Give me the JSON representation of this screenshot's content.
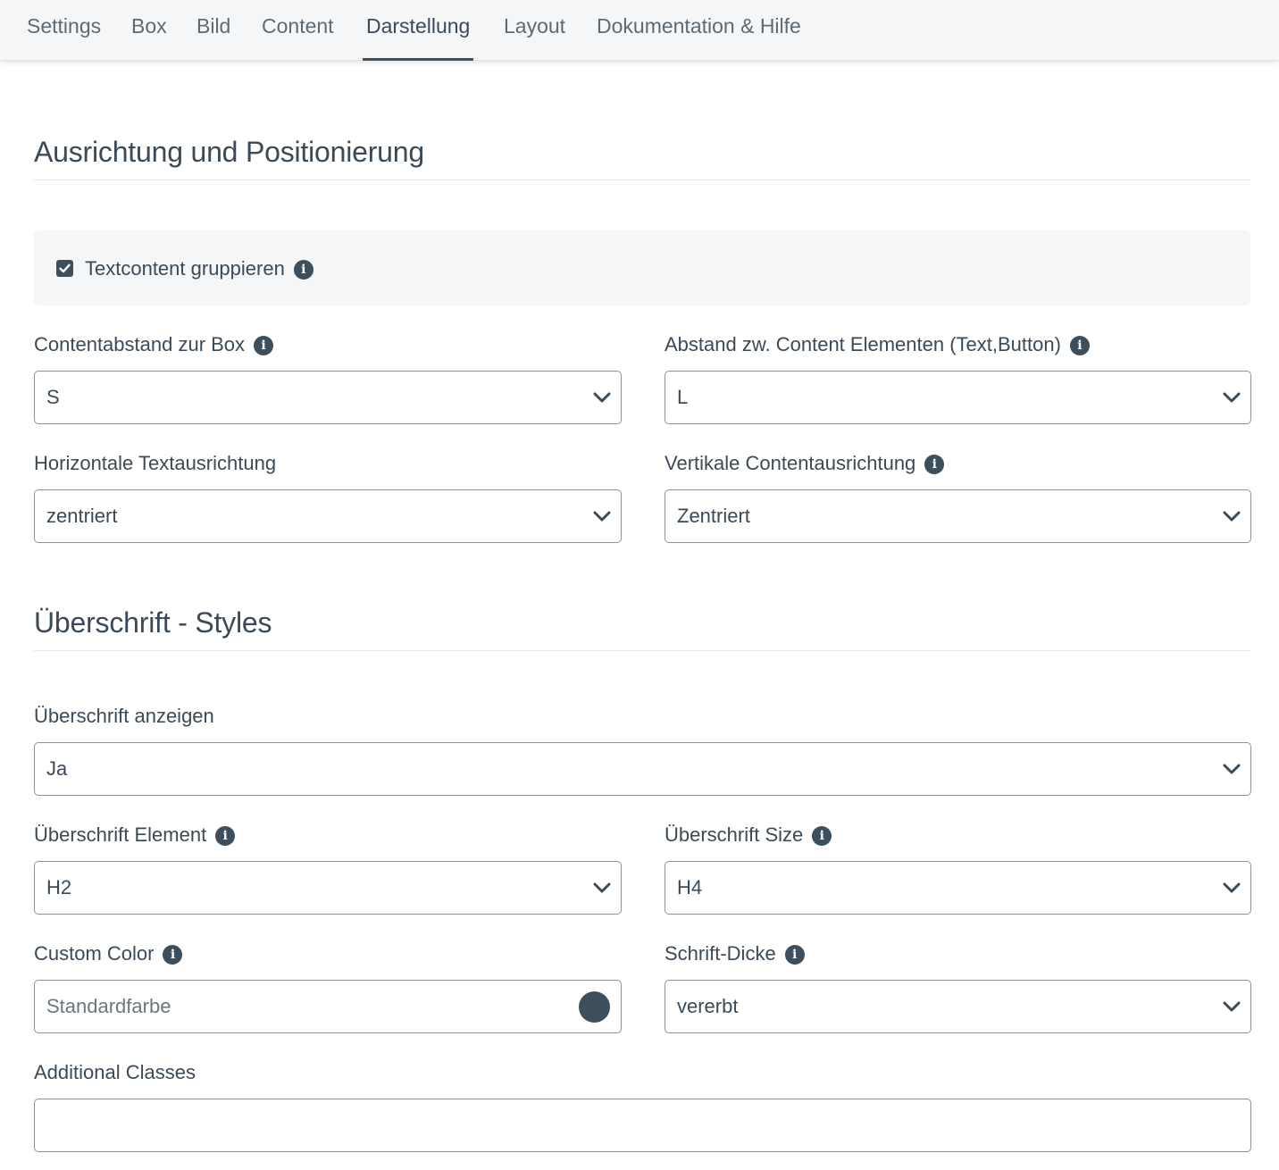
{
  "tabs": [
    {
      "label": "Settings",
      "active": false
    },
    {
      "label": "Box",
      "active": false
    },
    {
      "label": "Bild",
      "active": false
    },
    {
      "label": "Content",
      "active": false
    },
    {
      "label": "Darstellung",
      "active": true
    },
    {
      "label": "Layout",
      "active": false
    },
    {
      "label": "Dokumentation & Hilfe",
      "active": false
    }
  ],
  "section1": {
    "title": "Ausrichtung und Positionierung",
    "group_checkbox": {
      "label": "Textcontent gruppieren",
      "checked": true
    },
    "content_spacing": {
      "label": "Contentabstand zur Box",
      "value": "S"
    },
    "element_spacing": {
      "label": "Abstand zw. Content Elementen (Text,Button)",
      "value": "L"
    },
    "horizontal_align": {
      "label": "Horizontale Textausrichtung",
      "value": "zentriert"
    },
    "vertical_align": {
      "label": "Vertikale Contentausrichtung",
      "value": "Zentriert"
    }
  },
  "section2": {
    "title": "Überschrift - Styles",
    "show_heading": {
      "label": "Überschrift anzeigen",
      "value": "Ja"
    },
    "heading_element": {
      "label": "Überschrift Element",
      "value": "H2"
    },
    "heading_size": {
      "label": "Überschrift Size",
      "value": "H4"
    },
    "custom_color": {
      "label": "Custom Color",
      "placeholder": "Standardfarbe",
      "swatch_color": "#3d4e5c"
    },
    "font_weight": {
      "label": "Schrift-Dicke",
      "value": "vererbt"
    },
    "additional_classes": {
      "label": "Additional Classes",
      "value": ""
    }
  },
  "icons": {
    "info": "info-circle-icon",
    "chevron": "chevron-down-icon",
    "check": "check-icon"
  },
  "colors": {
    "accent": "#3d4e5c",
    "text": "#3b4a58",
    "tab_bar": "#f5f6f8",
    "group_bg": "#f4f6f8",
    "border": "#8b949c"
  }
}
